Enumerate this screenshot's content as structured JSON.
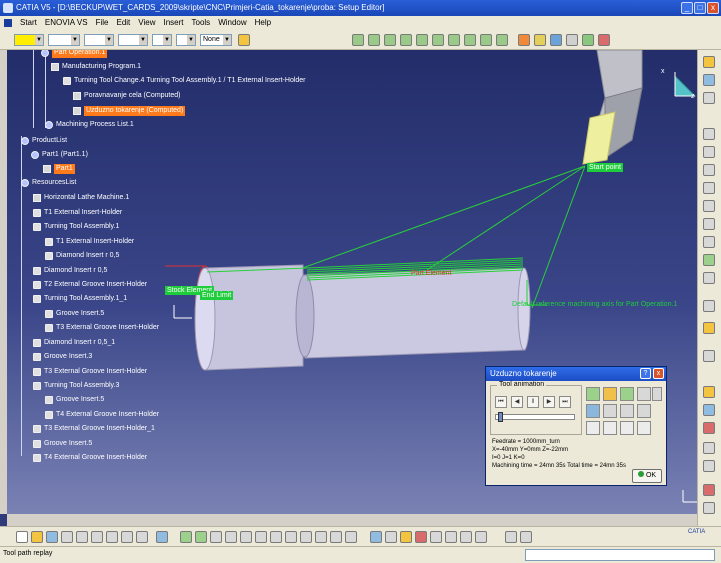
{
  "window": {
    "title": "CATIA V5 - [D:\\BECKUP\\WET_CARDS_2009\\skripte\\CNC\\Primjeri-Catia_tokarenje\\proba: Setup Editor]",
    "minimize": "_",
    "restore": "□",
    "close": "x"
  },
  "menu": {
    "items": [
      "Start",
      "ENOVIA VS",
      "File",
      "Edit",
      "View",
      "Insert",
      "Tools",
      "Window",
      "Help"
    ]
  },
  "toolbar": {
    "line_width_value": "",
    "color_value": "",
    "layer_value": "None",
    "dropdown_arrow": "▼"
  },
  "tree": {
    "part_operation": "Part Operation.1",
    "manufacturing_program": "Manufacturing Program.1",
    "tool_change": "Turning Tool Change.4  Turning Tool Assembly.1 / T1 External Insert-Holder",
    "poravnavanje": "Poravnavanje cela (Computed)",
    "uzduzno": "Uzduzno tokarenje (Computed)",
    "process_list": "Machining Process List.1",
    "product_list": "ProductList",
    "part1_root": "Part1 (Part1.1)",
    "part1": "Part1",
    "resources_list": "ResourcesList",
    "resources": [
      "Horizontal Lathe Machine.1",
      "T1 External Insert-Holder",
      "Turning Tool Assembly.1",
      "T1 External Insert-Holder",
      "Diamond Insert r 0,5",
      "Diamond Insert r 0,5",
      "T2 External Groove Insert-Holder",
      "Turning Tool Assembly.1_1",
      "Groove Insert.5",
      "T3 External Groove Insert-Holder",
      "Diamond Insert r 0,5_1",
      "Groove Insert.3",
      "T3 External Groove Insert-Holder",
      "Turning Tool Assembly.3",
      "Groove Insert.5",
      "T4 External Groove Insert-Holder",
      "T3 External Groove Insert-Holder_1",
      "Groove Insert.5",
      "T4 External Groove Insert-Holder"
    ]
  },
  "viewport": {
    "start_point": "Start point",
    "stock_element": "Stock Element",
    "end_limit": "End Limit",
    "part_element": "Part Element",
    "ref_axis": "Default reference machining axis for Part Operation.1",
    "axis_z": "z",
    "axis_x": "x",
    "axis_y": "y"
  },
  "dialog": {
    "title": "Uzduzno tokarenje",
    "help": "?",
    "close": "x",
    "tool_animation": "Tool animation",
    "anim_buttons": [
      "⏮",
      "◀",
      "‖",
      "▶",
      "⏭"
    ],
    "feedrate": "Feedrate = 1000mm_turn",
    "position": "X=-40mm Y=0mm Z=-22mm",
    "ijk": "I=0 J=1 K=0",
    "machining_time": "Machining time = 24mn 35s     Total time = 24mn 35s",
    "ok": "OK"
  },
  "status": {
    "text": "Tool path replay"
  },
  "brand": {
    "logo_text": "CATIA"
  },
  "colors": {
    "title_blue": "#1a47b8",
    "tree_highlight": "#ff7a1a",
    "label_green": "#1fcc3b",
    "toolpath_green": "#28d03a",
    "cylinder": "#c7c5de",
    "insert_yellow": "#eef0a0"
  }
}
